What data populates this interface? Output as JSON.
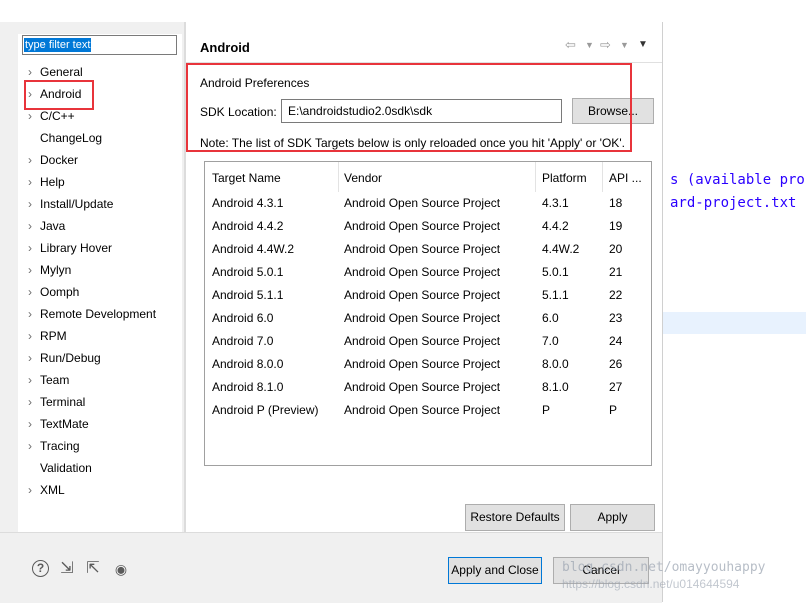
{
  "background_editor": {
    "lines": [
      "s (available pro",
      "ard-project.txt"
    ]
  },
  "filter": {
    "value": "type filter text"
  },
  "nav": {
    "items": [
      {
        "label": "General",
        "chevron": true
      },
      {
        "label": "Android",
        "chevron": true,
        "selected": true
      },
      {
        "label": "C/C++",
        "chevron": true
      },
      {
        "label": "ChangeLog",
        "chevron": false
      },
      {
        "label": "Docker",
        "chevron": true
      },
      {
        "label": "Help",
        "chevron": true
      },
      {
        "label": "Install/Update",
        "chevron": true
      },
      {
        "label": "Java",
        "chevron": true
      },
      {
        "label": "Library Hover",
        "chevron": true
      },
      {
        "label": "Mylyn",
        "chevron": true
      },
      {
        "label": "Oomph",
        "chevron": true
      },
      {
        "label": "Remote Development",
        "chevron": true
      },
      {
        "label": "RPM",
        "chevron": true
      },
      {
        "label": "Run/Debug",
        "chevron": true
      },
      {
        "label": "Team",
        "chevron": true
      },
      {
        "label": "Terminal",
        "chevron": true
      },
      {
        "label": "TextMate",
        "chevron": true
      },
      {
        "label": "Tracing",
        "chevron": true
      },
      {
        "label": "Validation",
        "chevron": false
      },
      {
        "label": "XML",
        "chevron": true
      }
    ]
  },
  "page": {
    "title": "Android",
    "prefs_label": "Android Preferences",
    "sdk_label": "SDK Location:",
    "sdk_value": "E:\\androidstudio2.0sdk\\sdk",
    "browse_label": "Browse...",
    "note": "Note: The list of SDK Targets below is only reloaded once you hit 'Apply' or 'OK'."
  },
  "table": {
    "headers": [
      "Target Name",
      "Vendor",
      "Platform",
      "API ..."
    ],
    "rows": [
      [
        "Android 4.3.1",
        "Android Open Source Project",
        "4.3.1",
        "18"
      ],
      [
        "Android 4.4.2",
        "Android Open Source Project",
        "4.4.2",
        "19"
      ],
      [
        "Android 4.4W.2",
        "Android Open Source Project",
        "4.4W.2",
        "20"
      ],
      [
        "Android 5.0.1",
        "Android Open Source Project",
        "5.0.1",
        "21"
      ],
      [
        "Android 5.1.1",
        "Android Open Source Project",
        "5.1.1",
        "22"
      ],
      [
        "Android 6.0",
        "Android Open Source Project",
        "6.0",
        "23"
      ],
      [
        "Android 7.0",
        "Android Open Source Project",
        "7.0",
        "24"
      ],
      [
        "Android 8.0.0",
        "Android Open Source Project",
        "8.0.0",
        "26"
      ],
      [
        "Android 8.1.0",
        "Android Open Source Project",
        "8.1.0",
        "27"
      ],
      [
        "Android P (Preview)",
        "Android Open Source Project",
        "P",
        "P"
      ]
    ]
  },
  "buttons": {
    "restore_defaults": "Restore Defaults",
    "apply": "Apply",
    "apply_and_close": "Apply and Close",
    "cancel": "Cancel"
  },
  "watermark": {
    "line1": "blog.csdn.net/omayyouhappy",
    "line2": "https://blog.csdn.net/u014644594"
  },
  "colors": {
    "highlight_red": "#e8343b",
    "selection_blue": "#0078d7"
  }
}
